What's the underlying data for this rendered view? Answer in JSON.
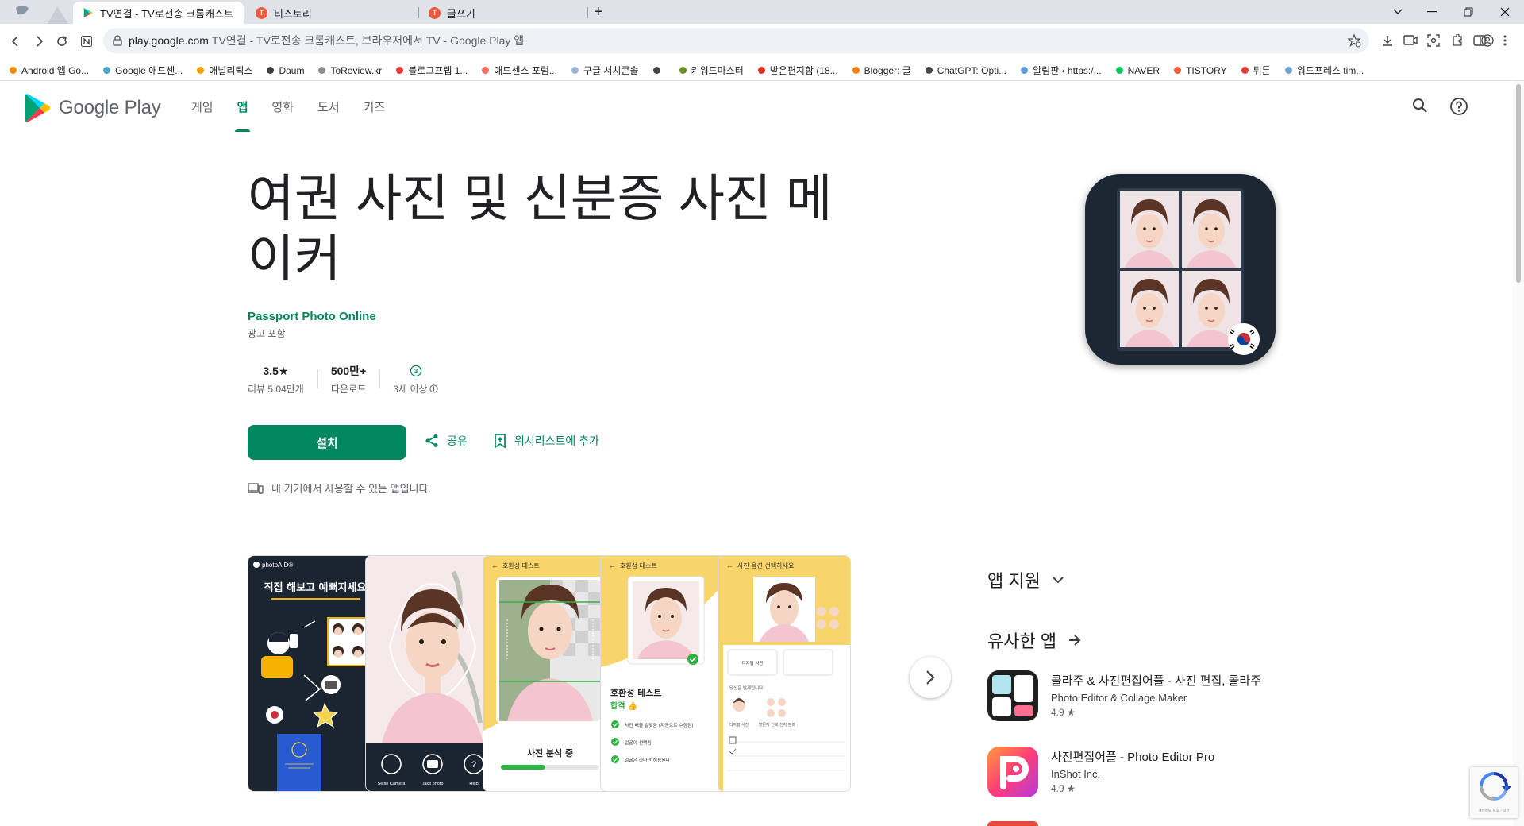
{
  "browser": {
    "tabs": [
      {
        "label": "TV연결 - TV로전송 크롬캐스트",
        "active": true
      },
      {
        "label": "티스토리",
        "active": false
      },
      {
        "label": "글쓰기",
        "active": false
      }
    ],
    "new_tab_label": "+",
    "address": {
      "host": "play.google.com",
      "path": "TV연결 - TV로전송 크롬캐스트, 브라우저에서 TV - Google Play 앱"
    },
    "bookmarks": [
      {
        "label": "Android 앱 Go...",
        "color": "#f28b00"
      },
      {
        "label": "Google 애드센...",
        "color": "#4aa3c8"
      },
      {
        "label": "애널리틱스",
        "color": "#f4a100"
      },
      {
        "label": "Daum",
        "color": "#3b3b3b"
      },
      {
        "label": "ToReview.kr",
        "color": "#888c93"
      },
      {
        "label": "블로그프렙 1...",
        "color": "#e53935"
      },
      {
        "label": "애드센스 포럼...",
        "color": "#ef6c5a"
      },
      {
        "label": "구글 서치콘솔",
        "color": "#9fb7d6"
      },
      {
        "label": "",
        "color": "#444444"
      },
      {
        "label": "키워드마스터",
        "color": "#6b8f24"
      },
      {
        "label": "받은편지함 (18...",
        "color": "#d93025"
      },
      {
        "label": "Blogger: 글",
        "color": "#f57c00"
      },
      {
        "label": "ChatGPT: Opti...",
        "color": "#444444"
      },
      {
        "label": "알림판 ‹ https:/...",
        "color": "#5b9bd5"
      },
      {
        "label": "NAVER",
        "color": "#03c75a"
      },
      {
        "label": "TISTORY",
        "color": "#ef5a3c"
      },
      {
        "label": "튀튼",
        "color": "#e53935"
      },
      {
        "label": "워드프레스 tim...",
        "color": "#6fa3c9"
      }
    ]
  },
  "header": {
    "brand": "Google Play",
    "nav": [
      {
        "label": "게임",
        "active": false
      },
      {
        "label": "앱",
        "active": true
      },
      {
        "label": "영화",
        "active": false
      },
      {
        "label": "도서",
        "active": false
      },
      {
        "label": "키즈",
        "active": false
      }
    ]
  },
  "app": {
    "title": "여권 사진 및 신분증 사진 메이커",
    "developer": "Passport Photo Online",
    "ads_note": "광고 포함",
    "stats": [
      {
        "top": "3.5★",
        "sub": "리뷰 5.04만개"
      },
      {
        "top": "500만+",
        "sub": "다운로드"
      },
      {
        "top": "3",
        "sub": "3세 이상"
      }
    ],
    "install_label": "설치",
    "share_label": "공유",
    "wishlist_label": "위시리스트에 추가",
    "device_note": "내 기기에서 사용할 수 있는 앱입니다."
  },
  "screenshots": {
    "shot1": {
      "logo": "photoAID®",
      "headline": "직접 해보고 예뻐지세요"
    },
    "shot2": {
      "buttons": [
        "Selfie Camera",
        "Take photo",
        "Help"
      ]
    },
    "shot3": {
      "header": "호환성 테스트",
      "caption": "사진 분석 중",
      "progress": 0.45
    },
    "shot4": {
      "header": "호환성 테스트",
      "title": "호환성 테스트",
      "result": "합격 👍",
      "checks": [
        "사진 배율 알맞음 (자동으로 수정됨)",
        "얼굴이 선택됨",
        "얼굴은 하나만 허용된다"
      ]
    },
    "shot5": {
      "header": "사진 옵션 선택하세요",
      "option": "디지털 사진",
      "sub": "당신은 받게됩니다",
      "labels": [
        "디지털 사진",
        "방문작 인쇄 전자 판매"
      ]
    }
  },
  "sidebar": {
    "app_support": "앱 지원",
    "similar_apps": "유사한 앱",
    "similar": [
      {
        "title": "콜라주 & 사진편집어플 - 사진 편집, 콜라주",
        "developer": "Photo Editor & Collage Maker",
        "rating": "4.9 ★"
      },
      {
        "title": "사진편집어플 - Photo Editor Pro",
        "developer": "InShot Inc.",
        "rating": "4.9 ★"
      }
    ]
  },
  "recaptcha": {
    "text": "개인정보 보호 - 약관"
  },
  "colors": {
    "brand_green": "#01875f",
    "icon_bg": "#1c2733"
  }
}
